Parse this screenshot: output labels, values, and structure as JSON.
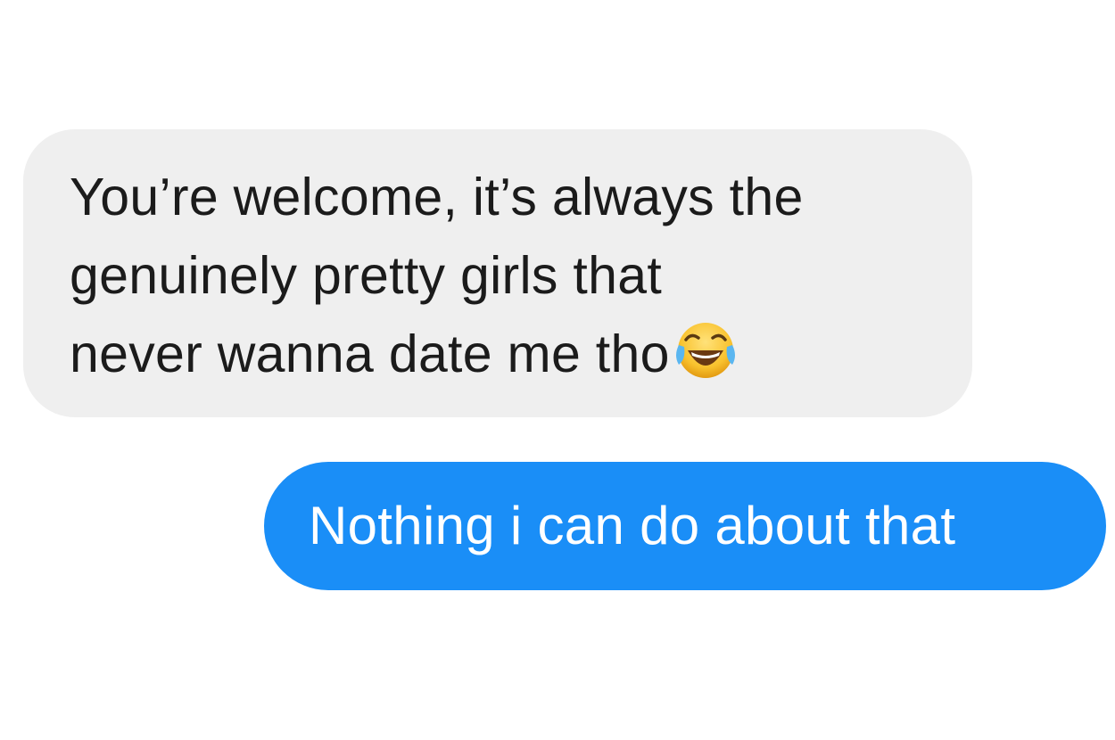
{
  "conversation": {
    "incoming_message": {
      "lines": [
        "You’re welcome, it’s always the",
        "genuinely pretty girls that",
        "never wanna date me tho"
      ],
      "emoji": "face-with-tears-of-joy-icon"
    },
    "outgoing_message": {
      "text": "Nothing i can do about that"
    }
  },
  "colors": {
    "incoming_bubble": "#efefef",
    "outgoing_bubble": "#1a8ef7",
    "incoming_text": "#1b1b1b",
    "outgoing_text": "#ffffff"
  }
}
